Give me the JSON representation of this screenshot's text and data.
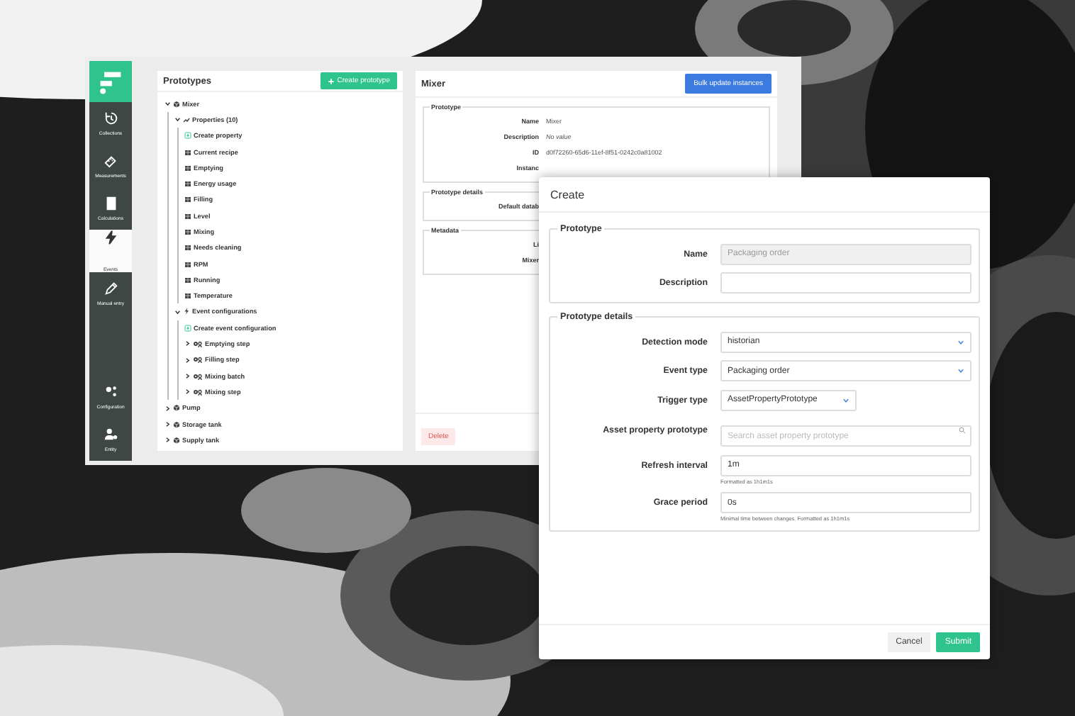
{
  "sidebar": {
    "items": [
      {
        "label": "Collections",
        "selected": false
      },
      {
        "label": "Measurements",
        "selected": false
      },
      {
        "label": "Calculations",
        "selected": false
      },
      {
        "label": "Events",
        "selected": true
      },
      {
        "label": "Manual entry",
        "selected": false
      }
    ],
    "bottom_items": [
      {
        "label": "Configuration",
        "selected": false
      },
      {
        "label": "Entity",
        "selected": false
      }
    ]
  },
  "prototypes": {
    "title": "Prototypes",
    "create_button": "Create prototype",
    "tree": [
      {
        "label": "Mixer",
        "kind": "asset",
        "expanded": true,
        "children": [
          {
            "label": "Properties (10)",
            "kind": "properties",
            "expanded": true,
            "children": [
              {
                "label": "Create property",
                "kind": "create"
              },
              {
                "label": "Current recipe",
                "kind": "property"
              },
              {
                "label": "Emptying",
                "kind": "property"
              },
              {
                "label": "Energy usage",
                "kind": "property"
              },
              {
                "label": "Filling",
                "kind": "property"
              },
              {
                "label": "Level",
                "kind": "property"
              },
              {
                "label": "Mixing",
                "kind": "property"
              },
              {
                "label": "Needs cleaning",
                "kind": "property"
              },
              {
                "label": "RPM",
                "kind": "property"
              },
              {
                "label": "Running",
                "kind": "property"
              },
              {
                "label": "Temperature",
                "kind": "property"
              }
            ]
          },
          {
            "label": "Event configurations",
            "kind": "events",
            "expanded": true,
            "children": [
              {
                "label": "Create event configuration",
                "kind": "create"
              },
              {
                "label": "Emptying step",
                "kind": "event",
                "expanded": false
              },
              {
                "label": "Filling step",
                "kind": "event",
                "expanded": false
              },
              {
                "label": "Mixing batch",
                "kind": "event",
                "expanded": false
              },
              {
                "label": "Mixing step",
                "kind": "event",
                "expanded": false
              }
            ]
          }
        ]
      },
      {
        "label": "Pump",
        "kind": "asset",
        "expanded": false
      },
      {
        "label": "Storage tank",
        "kind": "asset",
        "expanded": false
      },
      {
        "label": "Supply tank",
        "kind": "asset",
        "expanded": false
      }
    ]
  },
  "detail": {
    "title": "Mixer",
    "bulk_button": "Bulk update instances",
    "sections": [
      {
        "legend": "Prototype",
        "rows": [
          {
            "label": "Name",
            "value": "Mixer",
            "empty": false
          },
          {
            "label": "Description",
            "value": "No value",
            "empty": true
          },
          {
            "label": "ID",
            "value": "d0f72260-65d6-11ef-8f51-0242c0a81002",
            "empty": false
          },
          {
            "label": "Instanc"
          }
        ]
      },
      {
        "legend": "Prototype details",
        "rows": [
          {
            "label": "Default datab"
          }
        ]
      },
      {
        "legend": "Metadata",
        "rows": [
          {
            "label": "Li"
          },
          {
            "label": "Mixer"
          }
        ]
      }
    ],
    "delete_button": "Delete"
  },
  "dialog": {
    "title": "Create",
    "sections": [
      {
        "legend": "Prototype",
        "fields": [
          {
            "label": "Name",
            "kind": "text",
            "value": "Packaging order",
            "disabled": true
          },
          {
            "label": "Description",
            "kind": "text",
            "disabled": false
          }
        ]
      },
      {
        "legend": "Prototype details",
        "fields": [
          {
            "label": "Detection mode",
            "kind": "select",
            "value": "historian",
            "compact": false
          },
          {
            "label": "Event type",
            "kind": "select",
            "value": "Packaging order",
            "compact": false
          },
          {
            "label": "Trigger type",
            "kind": "select",
            "value": "AssetPropertyPrototype",
            "compact": true
          },
          {
            "label": "Asset property prototype",
            "kind": "search",
            "placeholder": "Search asset property prototype"
          },
          {
            "label": "Refresh interval",
            "kind": "text",
            "value": "1m",
            "disabled": false,
            "hint": "Formatted as 1h1m1s"
          },
          {
            "label": "Grace period",
            "kind": "text",
            "value": "0s",
            "disabled": false,
            "hint": "Minimal time between changes. Formatted as 1h1m1s"
          }
        ]
      }
    ],
    "cancel_button": "Cancel",
    "submit_button": "Submit"
  }
}
